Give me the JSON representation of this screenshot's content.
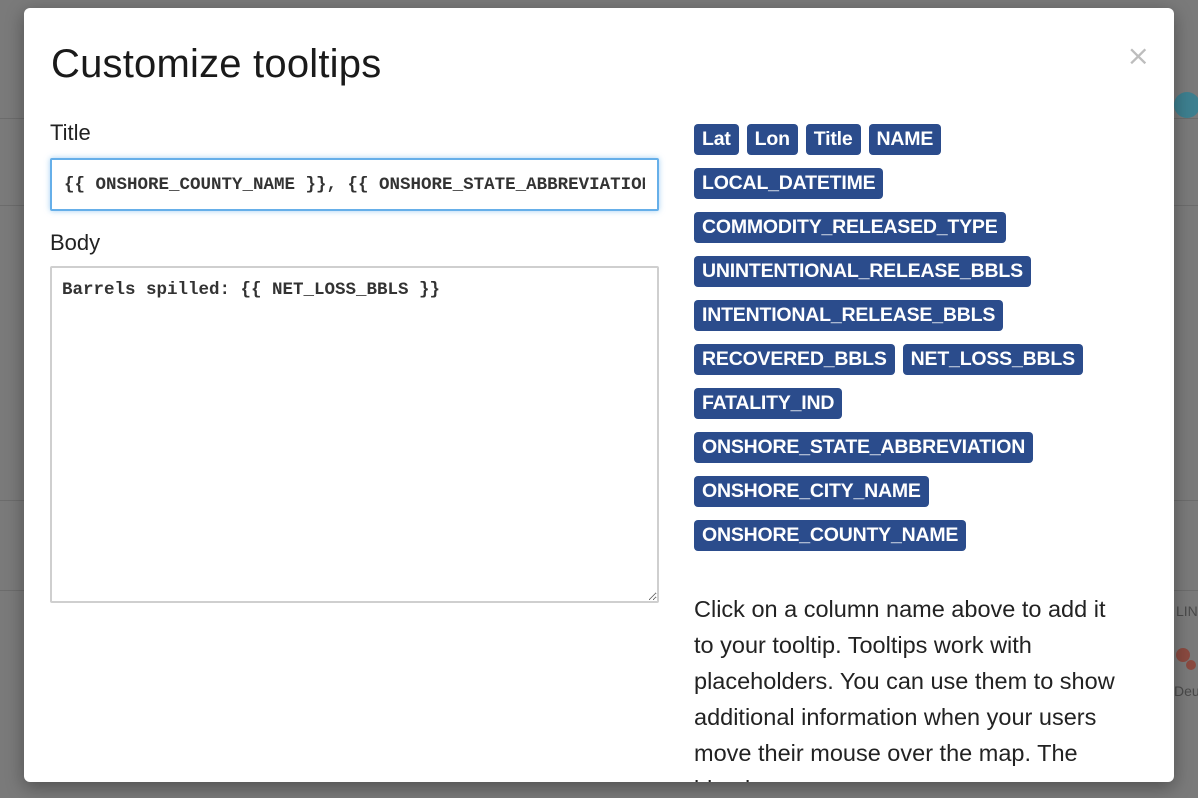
{
  "modal": {
    "title": "Customize tooltips",
    "close_label": "×"
  },
  "title_field": {
    "label": "Title",
    "value": "{{ ONSHORE_COUNTY_NAME }}, {{ ONSHORE_STATE_ABBREVIATION }}"
  },
  "body_field": {
    "label": "Body",
    "value": "Barrels spilled: {{ NET_LOSS_BBLS }}"
  },
  "columns": {
    "row1": [
      "Lat",
      "Lon",
      "Title",
      "NAME"
    ],
    "row2": [
      "LOCAL_DATETIME"
    ],
    "row3": [
      "COMMODITY_RELEASED_TYPE"
    ],
    "row4": [
      "UNINTENTIONAL_RELEASE_BBLS"
    ],
    "row5": [
      "INTENTIONAL_RELEASE_BBLS"
    ],
    "row6": [
      "RECOVERED_BBLS",
      "NET_LOSS_BBLS"
    ],
    "row7": [
      "FATALITY_IND"
    ],
    "row8": [
      "ONSHORE_STATE_ABBREVIATION"
    ],
    "row9": [
      "ONSHORE_CITY_NAME"
    ],
    "row10": [
      "ONSHORE_COUNTY_NAME"
    ]
  },
  "help": {
    "text": "Click on a column name above to add it to your tooltip. Tooltips work with placeholders. You can use them to show additional information when your users move their mouse over the map. The idea is:"
  },
  "background": {
    "partial_label_1": "LIN",
    "partial_label_2": "Deu"
  },
  "colors": {
    "tag_background": "#2b4c8c",
    "input_focus_border": "#66afe9",
    "backdrop": "#7a7a7a"
  }
}
